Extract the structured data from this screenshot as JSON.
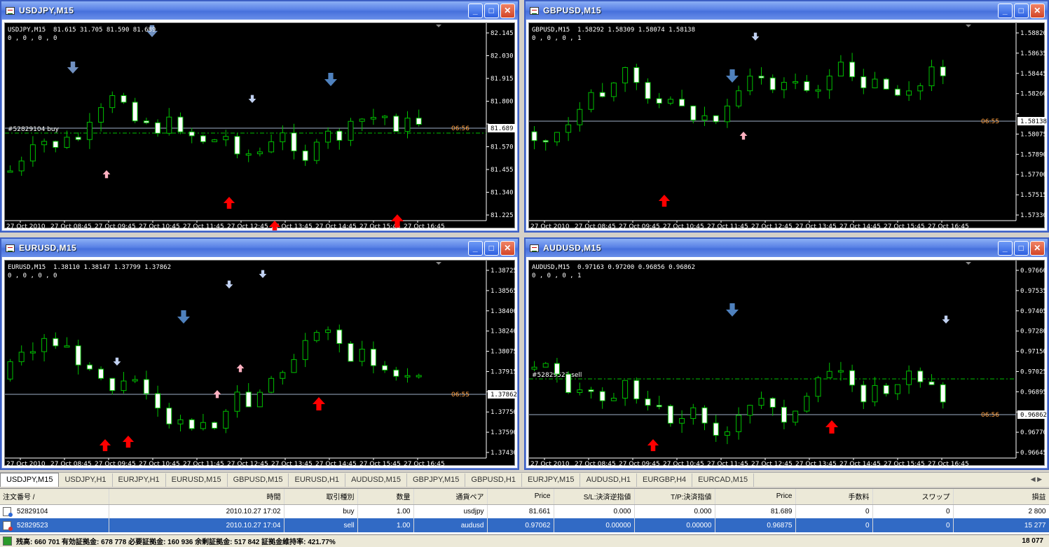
{
  "charts": [
    {
      "id": "usdjpy",
      "title": "USDJPY,M15",
      "info_line1": "USDJPY,M15  81.615 31.705 81.590 81.689",
      "info_line2": "0 , 0 , 0 , 0",
      "y_ticks": [
        "82.145",
        "82.030",
        "81.915",
        "81.800",
        "81.689",
        "81.570",
        "81.455",
        "81.340",
        "81.225"
      ],
      "current_price": "81.689",
      "x_ticks": [
        "27 Oct 2010",
        "27 Oct 08:45",
        "27 Oct 09:45",
        "27 Oct 10:45",
        "27 Oct 11:45",
        "27 Oct 12:45",
        "27 Oct 13:45",
        "27 Oct 14:45",
        "27 Oct 15:45",
        "27 Oct 16:45"
      ],
      "timer": "06:56",
      "order_label": "#52829104 buy"
    },
    {
      "id": "gbpusd",
      "title": "GBPUSD,M15",
      "info_line1": "GBPUSD,M15  1.58292 1.58309 1.58074 1.58138",
      "info_line2": "0 , 0 , 0 , 1",
      "y_ticks": [
        "1.58820",
        "1.58635",
        "1.58445",
        "1.58260",
        "1.58138",
        "1.58075",
        "1.57890",
        "1.57700",
        "1.57515",
        "1.57330"
      ],
      "current_price": "1.58138",
      "x_ticks": [
        "27 Oct 2010",
        "27 Oct 08:45",
        "27 Oct 09:45",
        "27 Oct 10:45",
        "27 Oct 11:45",
        "27 Oct 12:45",
        "27 Oct 13:45",
        "27 Oct 14:45",
        "27 Oct 15:45",
        "27 Oct 16:45"
      ],
      "timer": "06:55",
      "order_label": ""
    },
    {
      "id": "eurusd",
      "title": "EURUSD,M15",
      "info_line1": "EURUSD,M15  1.38110 1.38147 1.37799 1.37862",
      "info_line2": "0 , 0 , 0 , 0",
      "y_ticks": [
        "1.38725",
        "1.38565",
        "1.38400",
        "1.38240",
        "1.38075",
        "1.37915",
        "1.37862",
        "1.37750",
        "1.37590",
        "1.37430"
      ],
      "current_price": "1.37862",
      "x_ticks": [
        "27 Oct 2010",
        "27 Oct 08:45",
        "27 Oct 09:45",
        "27 Oct 10:45",
        "27 Oct 11:45",
        "27 Oct 12:45",
        "27 Oct 13:45",
        "27 Oct 14:45",
        "27 Oct 15:45",
        "27 Oct 16:45"
      ],
      "timer": "06:55",
      "order_label": ""
    },
    {
      "id": "audusd",
      "title": "AUDUSD,M15",
      "info_line1": "AUDUSD,M15  0.97163 0.97200 0.96856 0.96862",
      "info_line2": "0 , 0 , 0 , 1",
      "y_ticks": [
        "0.97660",
        "0.97535",
        "0.97405",
        "0.97280",
        "0.97150",
        "0.97025",
        "0.96895",
        "0.96862",
        "0.96770",
        "0.96645"
      ],
      "current_price": "0.96862",
      "x_ticks": [
        "27 Oct 2010",
        "27 Oct 08:45",
        "27 Oct 09:45",
        "27 Oct 10:45",
        "27 Oct 11:45",
        "27 Oct 12:45",
        "27 Oct 13:45",
        "27 Oct 14:45",
        "27 Oct 15:45",
        "27 Oct 16:45"
      ],
      "timer": "06:56",
      "order_label": "#52829523 sell"
    }
  ],
  "tabs": [
    "USDJPY,M15",
    "USDJPY,H1",
    "EURJPY,H1",
    "EURUSD,M15",
    "GBPUSD,M15",
    "EURUSD,H1",
    "AUDUSD,M15",
    "GBPJPY,M15",
    "GBPUSD,H1",
    "EURJPY,M15",
    "AUDUSD,H1",
    "EURGBP,H4",
    "EURCAD,M15"
  ],
  "terminal": {
    "headers": [
      "注文番号",
      "時間",
      "取引種別",
      "数量",
      "通貨ペア",
      "Price",
      "S/L:決済逆指値",
      "T/P:決済指値",
      "Price",
      "手数料",
      "スワップ",
      "損益"
    ],
    "rows": [
      {
        "ticket": "52829104",
        "time": "2010.10.27 17:02",
        "type": "buy",
        "lots": "1.00",
        "symbol": "usdjpy",
        "open": "81.661",
        "sl": "0.000",
        "tp": "0.000",
        "price": "81.689",
        "commission": "0",
        "swap": "0",
        "profit": "2 800"
      },
      {
        "ticket": "52829523",
        "time": "2010.10.27 17:04",
        "type": "sell",
        "lots": "1.00",
        "symbol": "audusd",
        "open": "0.97062",
        "sl": "0.00000",
        "tp": "0.00000",
        "price": "0.96875",
        "commission": "0",
        "swap": "0",
        "profit": "15 277"
      }
    ],
    "status_text": "残高: 660 701  有効証拠金: 678 778  必要証拠金: 160 936  余剰証拠金: 517 842  証拠金維持率: 421.77%",
    "total_profit": "18 077"
  },
  "colors": {
    "up": "#00c000",
    "body": "#ffffff",
    "arrow_up": "#ff0000",
    "arrow_down": "#4f81bd",
    "price": "#ffa040"
  }
}
